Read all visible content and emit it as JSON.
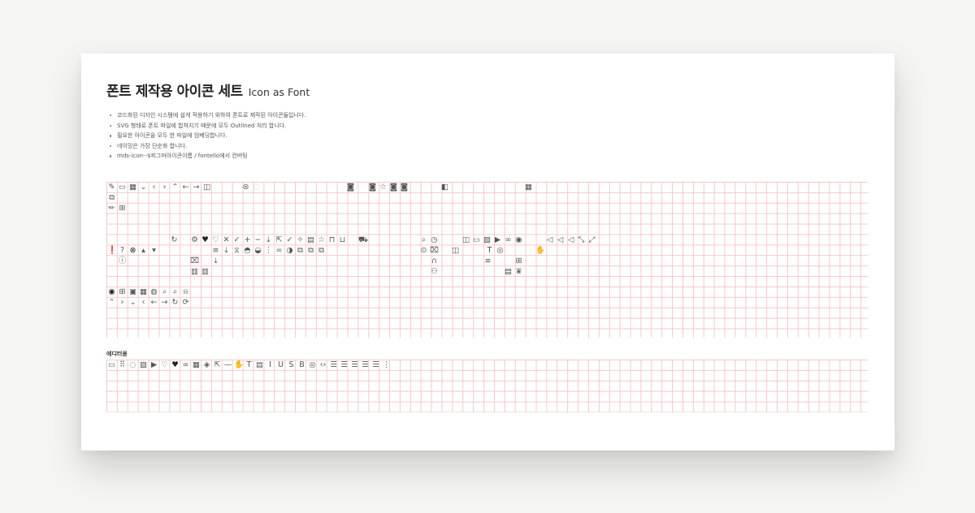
{
  "title": {
    "korean": "폰트 제작용 아이콘 세트",
    "english": "Icon as Font"
  },
  "notes": [
    "코드화된 디자인 시스템에 쉽게 적용하기 위하여 폰트로 제작된 아이콘들입니다.",
    "SVG 형태로 폰트 파일에 합쳐지기 때문에 모두 Outlined 처리 합니다.",
    "필요한 아이콘을 모두 한 파일에 임베딩합니다.",
    "네이밍은 가장 단순화 합니다.",
    "mds-icon--$피그마아이콘이름 / fontello에서 컨버팅"
  ],
  "editor_section_label": "에디터용",
  "colors": {
    "page_bg": "#f5f5f3",
    "card_bg": "#ffffff",
    "grid_line": "#f3c9c9",
    "icon_color": "#555555"
  },
  "icons": {
    "r1": [
      {
        "n": "edit-pencil-icon",
        "g": "✎"
      },
      {
        "n": "document-icon",
        "g": "▭"
      },
      {
        "n": "save-icon",
        "g": "▦"
      },
      {
        "n": "chevron-down-icon",
        "g": "⌄"
      },
      {
        "n": "chevron-left-icon",
        "g": "‹"
      },
      {
        "n": "chevron-right-icon",
        "g": "›"
      },
      {
        "n": "chevron-up-icon",
        "g": "⌃"
      },
      {
        "n": "arrow-left-icon",
        "g": "←"
      },
      {
        "n": "arrow-right-icon",
        "g": "→"
      },
      {
        "n": "book-icon",
        "g": "◫"
      },
      {
        "n": "badge-icon",
        "g": "⊜"
      },
      {
        "n": "chat-icon",
        "g": "◌"
      },
      {
        "n": "camera-icon",
        "g": "◙"
      },
      {
        "n": "camera-icon",
        "g": "◙"
      },
      {
        "n": "star-icon",
        "g": "☆"
      },
      {
        "n": "camera-icon",
        "g": "◙"
      },
      {
        "n": "camera-icon",
        "g": "◙"
      },
      {
        "n": "gallery-icon",
        "g": "◧"
      },
      {
        "n": "grid-icon",
        "g": "▦"
      }
    ],
    "r2": [
      {
        "n": "external-edit-icon",
        "g": "⧉"
      }
    ],
    "r3": [
      {
        "n": "pencil-icon",
        "g": "✏"
      },
      {
        "n": "layout-icon",
        "g": "⊞"
      }
    ],
    "r4": [
      {
        "n": "refresh-icon",
        "g": "↻"
      },
      {
        "n": "settings-icon",
        "g": "⚙"
      },
      {
        "n": "heart-filled-icon",
        "g": "♥"
      },
      {
        "n": "heart-icon",
        "g": "♡"
      },
      {
        "n": "close-icon",
        "g": "✕"
      },
      {
        "n": "check-icon",
        "g": "✓"
      },
      {
        "n": "plus-icon",
        "g": "+"
      },
      {
        "n": "minus-icon",
        "g": "−"
      },
      {
        "n": "download-icon",
        "g": "⤓"
      },
      {
        "n": "share-icon",
        "g": "⇱"
      },
      {
        "n": "check-icon",
        "g": "✓"
      },
      {
        "n": "sparkle-icon",
        "g": "✧"
      },
      {
        "n": "comment-icon",
        "g": "▤"
      },
      {
        "n": "star-icon",
        "g": "☆"
      },
      {
        "n": "lock-icon",
        "g": "⊓"
      },
      {
        "n": "unlock-icon",
        "g": "⊔"
      },
      {
        "n": "delivery-icon",
        "g": "⛟"
      },
      {
        "n": "search-icon",
        "g": "⌕"
      },
      {
        "n": "clock-icon",
        "g": "◷"
      },
      {
        "n": "book-icon",
        "g": "◫"
      },
      {
        "n": "slides-icon",
        "g": "▭"
      },
      {
        "n": "image-icon",
        "g": "▨"
      },
      {
        "n": "play-icon",
        "g": "▶"
      },
      {
        "n": "link-icon",
        "g": "∞"
      },
      {
        "n": "camera-icon",
        "g": "◉"
      },
      {
        "n": "volume-icon",
        "g": "◁"
      },
      {
        "n": "volume-up-icon",
        "g": "◁"
      },
      {
        "n": "mute-icon",
        "g": "◁"
      },
      {
        "n": "collapse-icon",
        "g": "⤡"
      },
      {
        "n": "expand-icon",
        "g": "⤢"
      }
    ],
    "r5": [
      {
        "n": "alert-filled-icon",
        "g": "❗"
      },
      {
        "n": "help-icon",
        "g": "?"
      },
      {
        "n": "close-circle-icon",
        "g": "⊗"
      },
      {
        "n": "caret-up-icon",
        "g": "▴"
      },
      {
        "n": "caret-down-icon",
        "g": "▾"
      },
      {
        "n": "menu-icon",
        "g": "≡"
      },
      {
        "n": "tray-download-icon",
        "g": "⤓"
      },
      {
        "n": "filter-icon",
        "g": "⧖"
      },
      {
        "n": "thumbs-up-icon",
        "g": "◓"
      },
      {
        "n": "thumbs-down-icon",
        "g": "◒"
      },
      {
        "n": "more-vertical-icon",
        "g": "⋮"
      },
      {
        "n": "equals-icon",
        "g": "="
      },
      {
        "n": "mention-icon",
        "g": "◑"
      },
      {
        "n": "copy-icon",
        "g": "⧉"
      },
      {
        "n": "copy-icon",
        "g": "⧉"
      },
      {
        "n": "copy-icon",
        "g": "⧉"
      },
      {
        "n": "location-icon",
        "g": "⊙"
      },
      {
        "n": "trash-icon",
        "g": "⌧"
      },
      {
        "n": "book-icon",
        "g": "◫"
      },
      {
        "n": "text-icon",
        "g": "T"
      },
      {
        "n": "eye-icon",
        "g": "◎"
      },
      {
        "n": "hand-icon",
        "g": "✋"
      }
    ],
    "r6": [
      {
        "n": "info-icon",
        "g": "ⓘ"
      },
      {
        "n": "trash-icon",
        "g": "⌧"
      },
      {
        "n": "tray-icon",
        "g": "⤓"
      },
      {
        "n": "headset-icon",
        "g": "∩"
      },
      {
        "n": "list-icon",
        "g": "≡"
      },
      {
        "n": "file-add-icon",
        "g": "⊞"
      }
    ],
    "r7": [
      {
        "n": "store-icon",
        "g": "▥"
      },
      {
        "n": "store-icon",
        "g": "▥"
      },
      {
        "n": "user-icon",
        "g": "⚇"
      },
      {
        "n": "document-icon",
        "g": "▤"
      },
      {
        "n": "crown-icon",
        "g": "♛"
      }
    ],
    "r8": [
      {
        "n": "avatar-filled-icon",
        "g": "◉"
      },
      {
        "n": "add-square-icon",
        "g": "⊞"
      },
      {
        "n": "card-icon",
        "g": "▣"
      },
      {
        "n": "gallery-icon",
        "g": "▦"
      },
      {
        "n": "profile-icon",
        "g": "◍"
      },
      {
        "n": "search-icon",
        "g": "⌕"
      },
      {
        "n": "search-small-icon",
        "g": "⌕"
      },
      {
        "n": "bell-icon",
        "g": "⍾"
      }
    ],
    "r9": [
      {
        "n": "chevron-up-icon",
        "g": "⌃"
      },
      {
        "n": "chevron-right-icon",
        "g": "›"
      },
      {
        "n": "chevron-down-icon",
        "g": "⌄"
      },
      {
        "n": "chevron-left-icon",
        "g": "‹"
      },
      {
        "n": "arrow-left-icon",
        "g": "←"
      },
      {
        "n": "arrow-right-icon",
        "g": "→"
      },
      {
        "n": "refresh-icon",
        "g": "↻"
      },
      {
        "n": "sync-icon",
        "g": "⟳"
      }
    ],
    "editor": [
      {
        "n": "document-icon",
        "g": "▭"
      },
      {
        "n": "drag-handle-icon",
        "g": "⠿"
      },
      {
        "n": "speech-bubble-icon",
        "g": "◌"
      },
      {
        "n": "image-icon",
        "g": "▨"
      },
      {
        "n": "video-icon",
        "g": "▶"
      },
      {
        "n": "heart-icon",
        "g": "♡"
      },
      {
        "n": "heart-filled-icon",
        "g": "♥"
      },
      {
        "n": "link-icon",
        "g": "∞"
      },
      {
        "n": "gallery-icon",
        "g": "▦"
      },
      {
        "n": "embed-icon",
        "g": "◈"
      },
      {
        "n": "external-link-icon",
        "g": "⇱"
      },
      {
        "n": "divider-icon",
        "g": "—"
      },
      {
        "n": "hand-icon",
        "g": "✋"
      },
      {
        "n": "text-icon",
        "g": "T"
      },
      {
        "n": "quote-icon",
        "g": "▤"
      },
      {
        "n": "italic-icon",
        "g": "I"
      },
      {
        "n": "underline-icon",
        "g": "U"
      },
      {
        "n": "strikethrough-icon",
        "g": "S"
      },
      {
        "n": "bold-icon",
        "g": "B"
      },
      {
        "n": "hide-icon",
        "g": "◎"
      },
      {
        "n": "code-icon",
        "g": "‹›"
      },
      {
        "n": "list-bullet-icon",
        "g": "☰"
      },
      {
        "n": "align-left-icon",
        "g": "☰"
      },
      {
        "n": "align-center-icon",
        "g": "☰"
      },
      {
        "n": "align-right-icon",
        "g": "☰"
      },
      {
        "n": "align-justify-icon",
        "g": "☰"
      },
      {
        "n": "more-vertical-icon",
        "g": "⋮"
      }
    ]
  }
}
